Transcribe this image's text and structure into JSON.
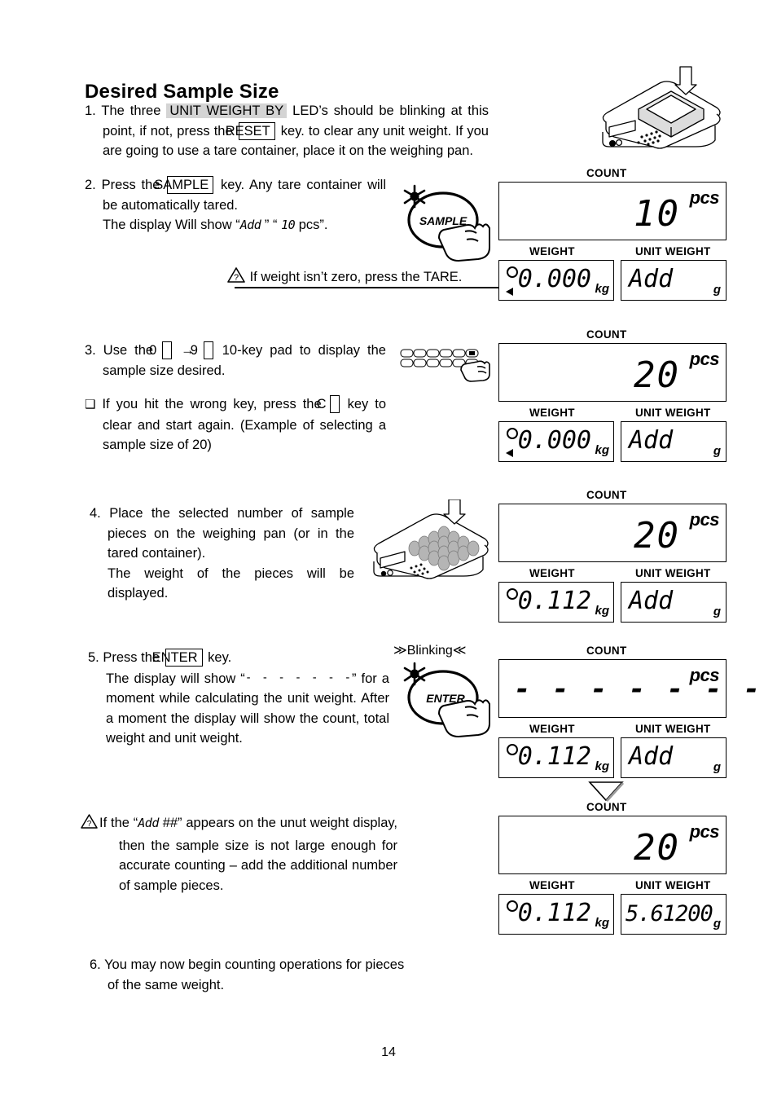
{
  "page": {
    "title": "Desired Sample Size",
    "number": "14"
  },
  "steps": [
    {
      "id": "step-1",
      "number": "1.",
      "parts": [
        "The three ",
        "UNIT WEIGHT BY",
        " LED’s should be blinking at this point, if not, press the ",
        "RESET",
        " key. to clear any unit weight. If you are going to use a tare container, place it on the weighing pan."
      ]
    },
    {
      "id": "step-2",
      "number": "2.",
      "parts": [
        "Press the ",
        "SAMPLE",
        " key. Any tare container will be automatically tared.",
        "The display Will show “",
        "Add",
        " ” “ ",
        "10",
        " pcs”."
      ]
    },
    {
      "id": "step-3",
      "number": "3.",
      "parts": [
        "Use the ",
        "0",
        " → ",
        "9",
        " 10-key pad to display the sample size desired."
      ]
    },
    {
      "id": "bullet-wrong-key",
      "number": "❑",
      "parts": [
        "If you hit the wrong key, press the ",
        "C",
        " key to clear and start again. (Example of selecting a sample size of 20)"
      ]
    },
    {
      "id": "step-4",
      "number": "4.",
      "parts": [
        "Place the selected number of sample pieces on the weighing pan (or in the tared container).",
        "The weight of the pieces will be displayed."
      ]
    },
    {
      "id": "step-5",
      "number": "5.",
      "parts": [
        "Press the ",
        "ENTER",
        " key.",
        "The display will show “",
        "- - - - - - -",
        "” for a moment while calculating the unit weight. After a moment the display will show the count, total weight and unit weight."
      ]
    },
    {
      "id": "note-add",
      "number": "⚠",
      "parts": [
        "If the “",
        "Add",
        " ##” appears on the unut weight display, then the sample size is not large enough for accurate counting – add the additional number of sample pieces."
      ]
    },
    {
      "id": "step-6",
      "number": "6.",
      "parts": [
        "You may now begin counting operations for pieces of the same weight."
      ]
    }
  ],
  "tare_note": {
    "text": "If weight isn’t zero, press the TARE.",
    "icon": "warning-question-triangle"
  },
  "blinking_label": "≫Blinking≪",
  "button_art": {
    "sample_label": "SAMPLE",
    "enter_label": "ENTER"
  },
  "captions": {
    "count": "COUNT",
    "weight": "WEIGHT",
    "unit_weight": "UNIT  WEIGHT"
  },
  "units": {
    "pcs": "pcs",
    "kg": "kg",
    "g": "g"
  },
  "displays": [
    {
      "id": "display-step2",
      "count": "10",
      "weight": "0.000",
      "unit_weight": "Add",
      "show_indicator_circle": true,
      "show_indicator_triangle": true,
      "count_is_dashes": false
    },
    {
      "id": "display-step3",
      "count": "20",
      "weight": "0.000",
      "unit_weight": "Add",
      "show_indicator_circle": true,
      "show_indicator_triangle": true,
      "count_is_dashes": false
    },
    {
      "id": "display-step4",
      "count": "20",
      "weight": "0.112",
      "unit_weight": "Add",
      "show_indicator_circle": true,
      "show_indicator_triangle": false,
      "count_is_dashes": false
    },
    {
      "id": "display-step5-calculating",
      "count": "- - - - - - -",
      "weight": "0.112",
      "unit_weight": "Add",
      "show_indicator_circle": true,
      "show_indicator_triangle": false,
      "count_is_dashes": true
    },
    {
      "id": "display-step5-result",
      "count": "20",
      "weight": "0.112",
      "unit_weight": "5.61200",
      "show_indicator_circle": true,
      "show_indicator_triangle": false,
      "count_is_dashes": false
    }
  ],
  "colors": {
    "ink": "#000000",
    "highlight": "#d4d4d4",
    "art_fill": "#b5b5b5",
    "page_bg": "#ffffff"
  }
}
